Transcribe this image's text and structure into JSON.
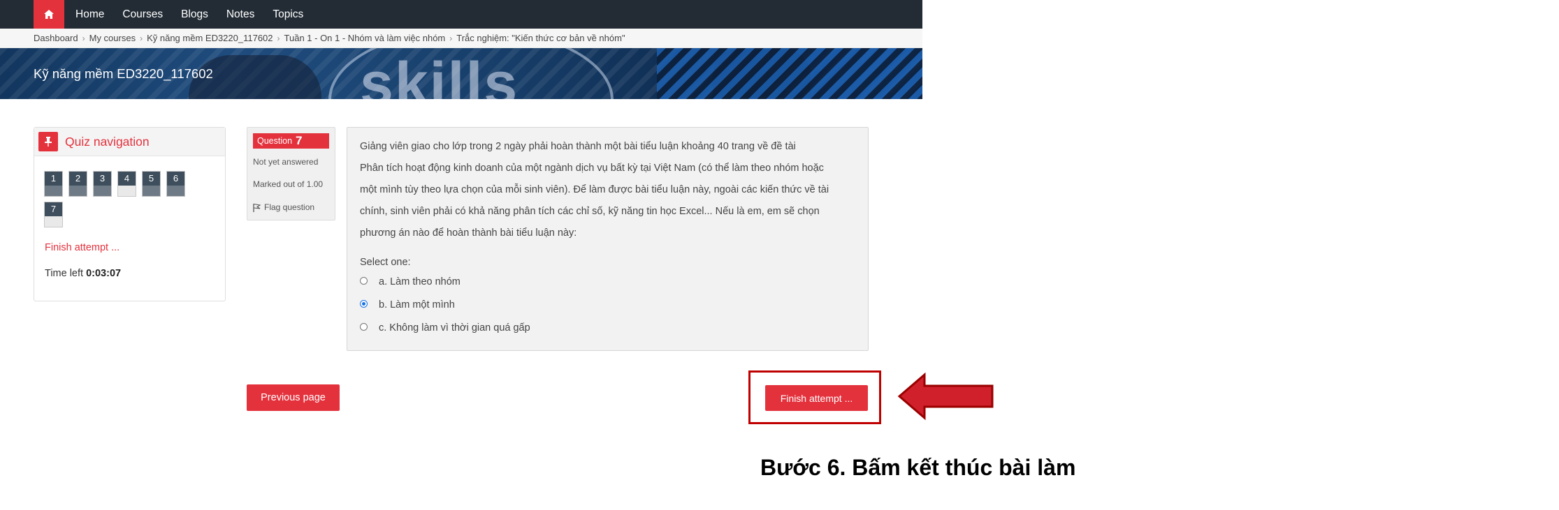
{
  "nav": {
    "items": [
      "Home",
      "Courses",
      "Blogs",
      "Notes",
      "Topics"
    ]
  },
  "breadcrumb": [
    "Dashboard",
    "My courses",
    "Kỹ năng mềm ED3220_117602",
    "Tuần 1 - On 1 - Nhóm và làm việc nhóm",
    "Trắc nghiệm: \"Kiến thức cơ bản về nhóm\""
  ],
  "banner": {
    "course_title": "Kỹ năng mềm ED3220_117602",
    "art_text": "skills"
  },
  "quiz_nav": {
    "title": "Quiz navigation",
    "buttons": [
      "1",
      "2",
      "3",
      "4",
      "5",
      "6",
      "7"
    ],
    "finish_link": "Finish attempt ...",
    "time_label": "Time left",
    "time_value": "0:03:07"
  },
  "question_info": {
    "label": "Question",
    "number": "7",
    "state": "Not yet answered",
    "grade": "Marked out of 1.00",
    "flag": "Flag question"
  },
  "question": {
    "lines": [
      "Giảng viên giao cho lớp trong 2 ngày phải hoàn thành một bài tiểu luận khoảng 40 trang về đề tài",
      "Phân tích hoạt động kinh doanh của một ngành dịch vụ bất kỳ tại Việt Nam (có thể làm theo nhóm hoặc",
      "một mình tùy theo lựa chọn của mỗi sinh viên). Để làm được bài tiểu luận này, ngoài các kiến thức về tài",
      "chính, sinh viên phải có khả năng phân tích các chỉ số, kỹ năng tin học Excel... Nếu là em, em sẽ chọn",
      "phương án nào để hoàn thành bài tiểu luận này:"
    ],
    "select_label": "Select one:",
    "options": [
      "a. Làm theo nhóm",
      "b. Làm một mình",
      "c. Không làm vì thời gian quá gấp"
    ],
    "selected_option": "b. Làm một mình"
  },
  "buttons": {
    "previous": "Previous page",
    "finish": "Finish attempt ..."
  },
  "caption": "Bước 6. Bấm kết thúc bài làm",
  "colors": {
    "accent": "#e4323d",
    "nav_bg": "#232c35",
    "highlight": "#c00000"
  }
}
